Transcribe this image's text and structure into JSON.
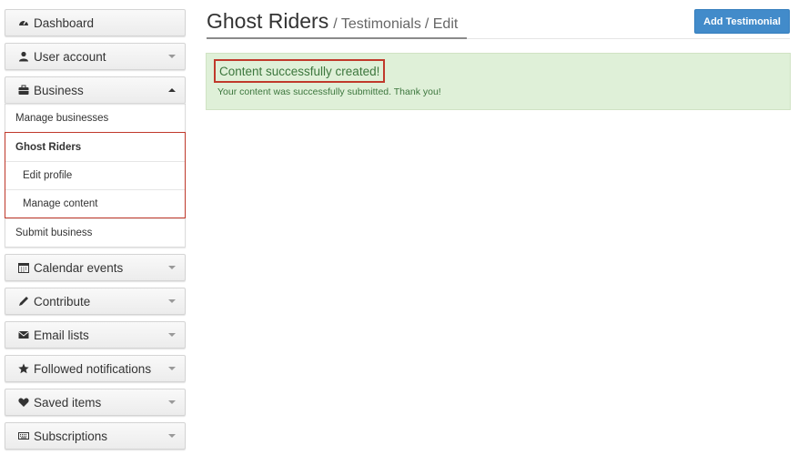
{
  "sidebar": {
    "dashboard": {
      "label": "Dashboard",
      "icon": "tachometer-icon"
    },
    "user_account": {
      "label": "User account",
      "icon": "user-icon"
    },
    "business": {
      "label": "Business",
      "icon": "briefcase-icon",
      "items": {
        "manage_businesses": "Manage businesses",
        "ghost_riders": "Ghost Riders",
        "edit_profile": "Edit profile",
        "manage_content": "Manage content",
        "submit_business": "Submit business"
      }
    },
    "calendar_events": {
      "label": "Calendar events",
      "icon": "calendar-icon"
    },
    "contribute": {
      "label": "Contribute",
      "icon": "pencil-icon"
    },
    "email_lists": {
      "label": "Email lists",
      "icon": "envelope-icon"
    },
    "followed_notifications": {
      "label": "Followed notifications",
      "icon": "star-icon"
    },
    "saved_items": {
      "label": "Saved items",
      "icon": "heart-icon"
    },
    "subscriptions": {
      "label": "Subscriptions",
      "icon": "keyboard-icon"
    }
  },
  "header": {
    "title": "Ghost Riders",
    "crumb1": "/ Testimonials",
    "crumb2": "/ Edit",
    "add_button": "Add Testimonial"
  },
  "alert": {
    "title": "Content successfully created!",
    "message": "Your content was successfully submitted. Thank you!"
  },
  "colors": {
    "accent": "#428bca",
    "success_bg": "#dff0d8",
    "success_text": "#3c763d",
    "highlight": "#c0392b"
  }
}
